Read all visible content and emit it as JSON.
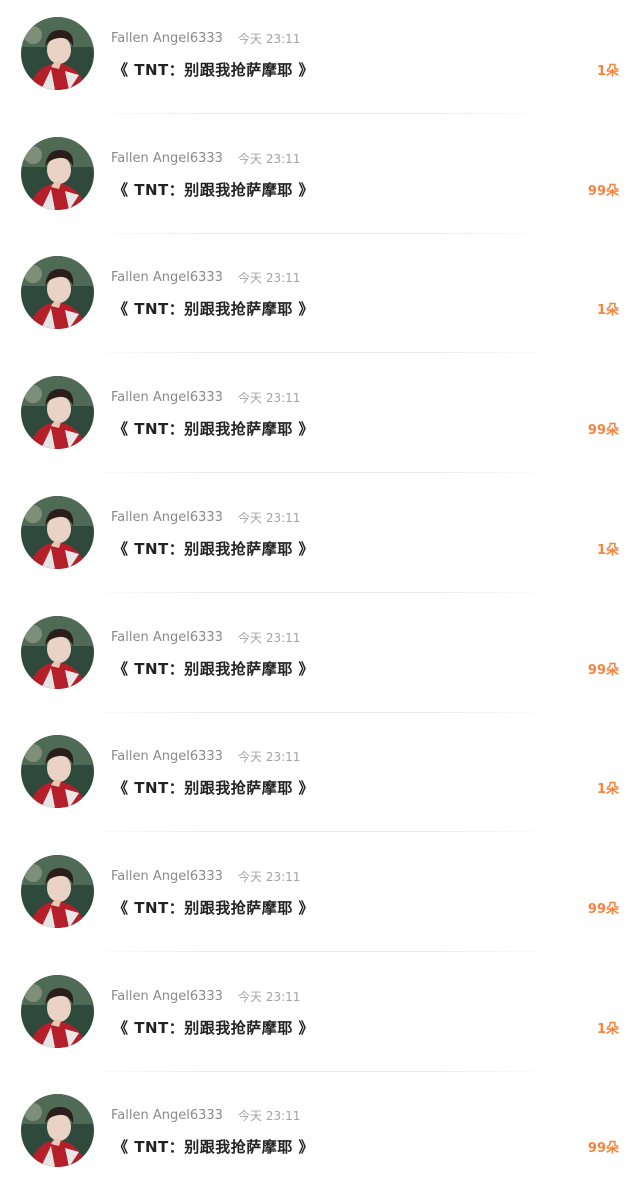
{
  "colors": {
    "count": "#f5843f",
    "username": "#8a8a8a",
    "time": "#a4a4a4",
    "title": "#232323",
    "divider": "#ececec"
  },
  "rows": [
    {
      "username": "Fallen Angel6333",
      "time": "今天 23:11",
      "title": "《 TNT：别跟我抢萨摩耶 》",
      "count": "1朵",
      "avatar_icon": "user-avatar-photo"
    },
    {
      "username": "Fallen Angel6333",
      "time": "今天 23:11",
      "title": "《 TNT：别跟我抢萨摩耶 》",
      "count": "99朵",
      "avatar_icon": "user-avatar-photo"
    },
    {
      "username": "Fallen Angel6333",
      "time": "今天 23:11",
      "title": "《 TNT：别跟我抢萨摩耶 》",
      "count": "1朵",
      "avatar_icon": "user-avatar-photo"
    },
    {
      "username": "Fallen Angel6333",
      "time": "今天 23:11",
      "title": "《 TNT：别跟我抢萨摩耶 》",
      "count": "99朵",
      "avatar_icon": "user-avatar-photo"
    },
    {
      "username": "Fallen Angel6333",
      "time": "今天 23:11",
      "title": "《 TNT：别跟我抢萨摩耶 》",
      "count": "1朵",
      "avatar_icon": "user-avatar-photo"
    },
    {
      "username": "Fallen Angel6333",
      "time": "今天 23:11",
      "title": "《 TNT：别跟我抢萨摩耶 》",
      "count": "99朵",
      "avatar_icon": "user-avatar-photo"
    },
    {
      "username": "Fallen Angel6333",
      "time": "今天 23:11",
      "title": "《 TNT：别跟我抢萨摩耶 》",
      "count": "1朵",
      "avatar_icon": "user-avatar-photo"
    },
    {
      "username": "Fallen Angel6333",
      "time": "今天 23:11",
      "title": "《 TNT：别跟我抢萨摩耶 》",
      "count": "99朵",
      "avatar_icon": "user-avatar-photo"
    },
    {
      "username": "Fallen Angel6333",
      "time": "今天 23:11",
      "title": "《 TNT：别跟我抢萨摩耶 》",
      "count": "1朵",
      "avatar_icon": "user-avatar-photo"
    },
    {
      "username": "Fallen Angel6333",
      "time": "今天 23:11",
      "title": "《 TNT：别跟我抢萨摩耶 》",
      "count": "99朵",
      "avatar_icon": "user-avatar-photo"
    }
  ]
}
